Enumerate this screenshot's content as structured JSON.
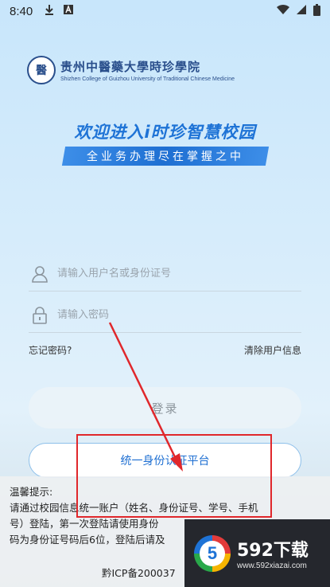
{
  "status_bar": {
    "time": "8:40",
    "icons": [
      "download-icon",
      "a-notification-icon",
      "wifi-icon",
      "signal-icon",
      "battery-icon"
    ]
  },
  "school": {
    "name_cn": "贵州中醫藥大學時珍學院",
    "name_en": "Shizhen College of Guizhou University of Traditional Chinese Medicine",
    "seal_char": "醫"
  },
  "welcome": "欢迎进入i时珍智慧校园",
  "slogan": "全业务办理尽在掌握之中",
  "form": {
    "username_placeholder": "请输入用户名或身份证号",
    "password_placeholder": "请输入密码",
    "forgot_password": "忘记密码?",
    "clear_user_info": "清除用户信息",
    "login_label": "登录",
    "platform_label": "统一身份认证平台"
  },
  "notice": {
    "title": "温馨提示:",
    "line1": "请通过校园信息统一账户（姓名、身份证号、学号、手机",
    "line2": "号）登陆，第一次登陆请使用身份",
    "line3": "码为身份证号码后6位，登陆后请及",
    "icp": "黔ICP备200037"
  },
  "watermark": {
    "logo_char": "5",
    "name": "592下载",
    "url": "www.592xiazai.com"
  },
  "colors": {
    "accent": "#1e6fd2",
    "annotation": "#e0272b"
  }
}
